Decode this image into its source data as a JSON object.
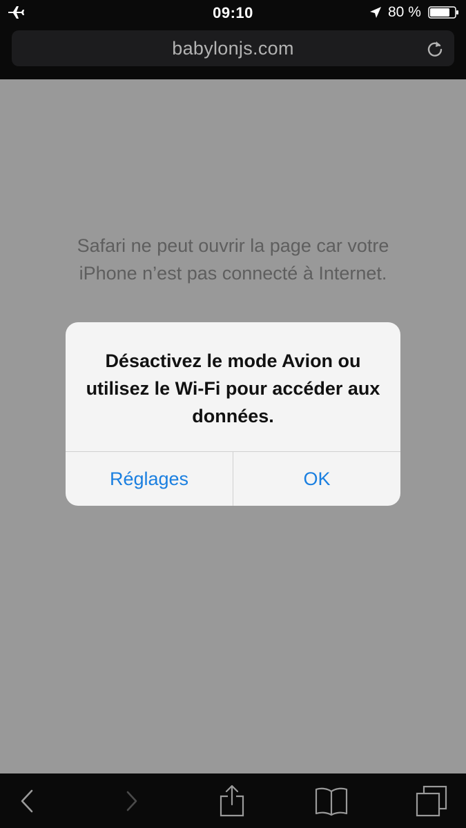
{
  "status_bar": {
    "time": "09:10",
    "battery_percent": "80 %",
    "battery_level": 0.8,
    "icons": [
      "airplane-icon",
      "location-icon",
      "battery-icon"
    ]
  },
  "url_bar": {
    "url": "babylonjs.com",
    "reload_icon": "reload-icon"
  },
  "page": {
    "error_message": "Safari ne peut ouvrir la page car votre iPhone n’est pas connecté à Internet."
  },
  "alert": {
    "message": "Désactivez le mode Avion ou utilisez le Wi-Fi pour accéder aux données.",
    "buttons": {
      "settings_label": "Réglages",
      "ok_label": "OK"
    },
    "accent_color": "#1a7fe0"
  },
  "toolbar": {
    "icons": [
      "back-icon",
      "forward-icon",
      "share-icon",
      "bookmarks-icon",
      "tabs-icon"
    ]
  }
}
